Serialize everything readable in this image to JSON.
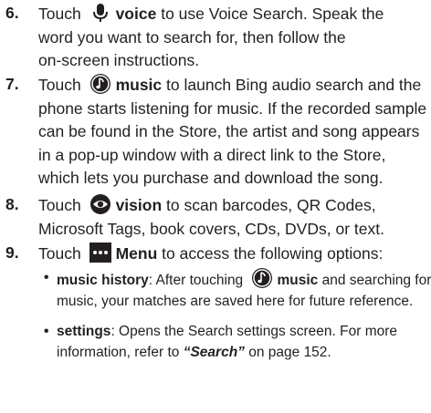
{
  "steps": [
    {
      "number": "6.",
      "pre": "Touch",
      "keyword": "voice",
      "icon": "microphone-icon",
      "line1_rest": "to use Voice Search. Speak the",
      "lines": [
        "word you want to search for, then follow the",
        "on-screen instructions."
      ]
    },
    {
      "number": "7.",
      "pre": "Touch",
      "keyword": "music",
      "icon": "music-note-icon",
      "line1_rest": "to launch Bing audio search and the",
      "lines": [
        "phone starts listening for music. If the recorded sample",
        "can be found in the Store, the artist and song appears",
        "in a pop-up window with a direct link to the Store,",
        "which lets you purchase and download the song."
      ]
    },
    {
      "number": "8.",
      "pre": "Touch",
      "keyword": "vision",
      "icon": "eye-icon",
      "line1_rest": "to scan barcodes, QR Codes,",
      "lines": [
        "Microsoft Tags, book covers, CDs, DVDs, or text."
      ]
    },
    {
      "number": "9.",
      "pre": "Touch",
      "keyword": "Menu",
      "icon": "more-dots-icon",
      "line1_rest": "to access the following options:",
      "lines": []
    }
  ],
  "options": [
    {
      "bullet": "•",
      "term": "music history",
      "line1_a": ": After touching",
      "icon": "music-note-icon",
      "keyword": "music",
      "line1_b": "and searching for",
      "line2": "music, your matches are saved here for future reference."
    },
    {
      "bullet": "•",
      "term": "settings",
      "line1": ": Opens the Search settings screen. For more",
      "line2_a": "information, refer to",
      "ref": "“Search”",
      "line2_b": " on page 152."
    }
  ],
  "colors": {
    "icon_bg": "#231f20",
    "icon_fg": "#ffffff",
    "text": "#231f20"
  }
}
